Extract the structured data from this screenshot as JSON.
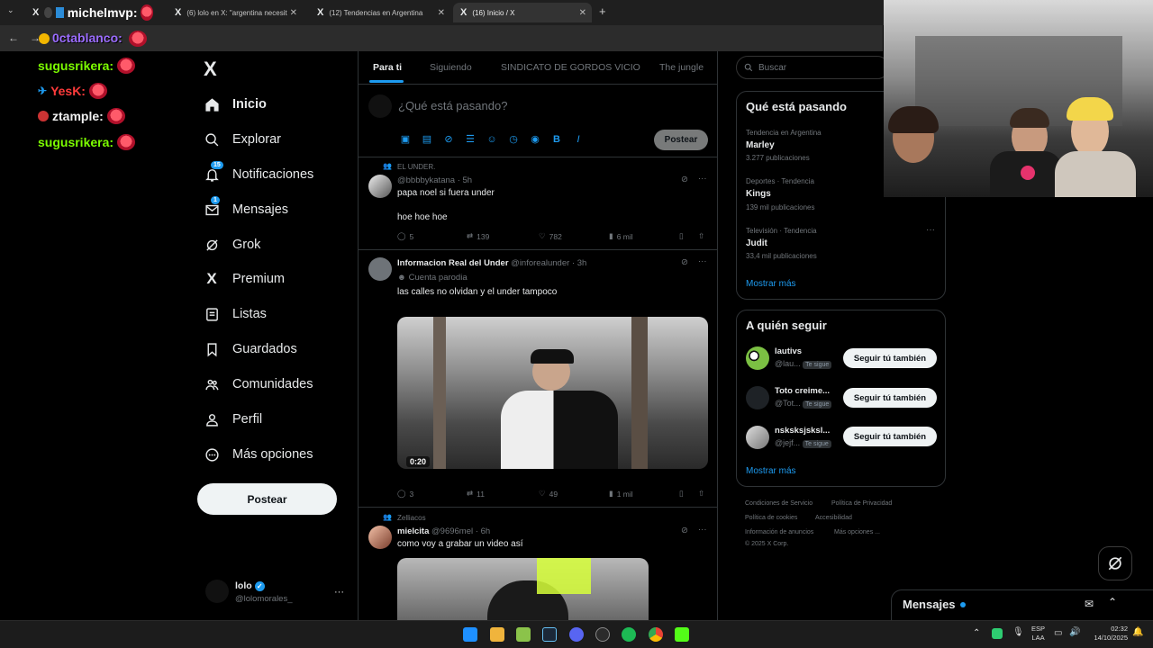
{
  "browser": {
    "tabs": [
      {
        "label": "michelmvp:",
        "overlay": true
      },
      {
        "label": "(6) lolo en X: \"argentina necesit"
      },
      {
        "label": "(12) Tendencias en Argentina"
      },
      {
        "label": "(16) Inicio / X"
      }
    ],
    "new_tab": "+",
    "address_overlay": "0ctablanco:"
  },
  "chat": [
    {
      "user": "sugusrikera:",
      "color": "#7cfc00"
    },
    {
      "user": "YesK:",
      "color": "#7cfc00"
    },
    {
      "user": "ztample:",
      "color": "#f0f0f0"
    },
    {
      "user": "sugusrikera:",
      "color": "#7cfc00"
    }
  ],
  "sidebar": {
    "logo": "X",
    "items": [
      {
        "label": "Inicio",
        "icon": "home-icon",
        "active": true
      },
      {
        "label": "Explorar",
        "icon": "search-icon"
      },
      {
        "label": "Notificaciones",
        "icon": "bell-icon",
        "badge": "15"
      },
      {
        "label": "Mensajes",
        "icon": "mail-icon",
        "badge": "1"
      },
      {
        "label": "Grok",
        "icon": "grok-icon"
      },
      {
        "label": "Premium",
        "icon": "x-icon"
      },
      {
        "label": "Listas",
        "icon": "list-icon"
      },
      {
        "label": "Guardados",
        "icon": "bookmark-icon"
      },
      {
        "label": "Comunidades",
        "icon": "people-icon"
      },
      {
        "label": "Perfil",
        "icon": "person-icon"
      },
      {
        "label": "Más opciones",
        "icon": "more-icon"
      }
    ],
    "post_button": "Postear",
    "account": {
      "name": "lolo",
      "handle": "@lolomorales_",
      "more": "···"
    }
  },
  "feed": {
    "tabs": [
      "Para ti",
      "Siguiendo",
      "SINDICATO DE GORDOS VICIO",
      "The jungle"
    ],
    "compose": {
      "placeholder": "¿Qué está pasando?",
      "button": "Postear"
    },
    "tweets": [
      {
        "context": "EL UNDER.",
        "name": "",
        "handle": "@bbbbykatana",
        "time": "· 5h",
        "lines": [
          "papa noel si fuera under",
          "hoe hoe hoe"
        ],
        "stats": {
          "replies": "5",
          "reposts": "139",
          "likes": "782",
          "views": "6 mil"
        }
      },
      {
        "context": "",
        "name": "Informacion Real del Under",
        "handle": "@inforealunder",
        "time": "· 3h",
        "sub": "Cuenta parodia",
        "lines": [
          "las calles no olvidan y el under tampoco"
        ],
        "video_duration": "0:20",
        "stats": {
          "replies": "3",
          "reposts": "11",
          "likes": "49",
          "views": "1 mil"
        }
      },
      {
        "context": "Zelliacos",
        "name": "mielcita",
        "handle": "@9696mel",
        "time": "· 6h",
        "lines": [
          "como voy a grabar un video así"
        ]
      }
    ]
  },
  "right": {
    "search_placeholder": "Buscar",
    "trends_title": "Qué está pasando",
    "trends": [
      {
        "context": "Tendencia en Argentina",
        "name": "Marley",
        "count": "3.277 publicaciones"
      },
      {
        "context": "Deportes · Tendencia",
        "name": "Kings",
        "count": "139 mil publicaciones"
      },
      {
        "context": "Televisión · Tendencia",
        "name": "Judit",
        "count": "33,4 mil publicaciones"
      }
    ],
    "show_more": "Mostrar más",
    "follow_title": "A quién seguir",
    "follow": [
      {
        "name": "lautivs",
        "handle": "@lau...",
        "tag": "Te sigue",
        "button": "Seguir tú también"
      },
      {
        "name": "Toto creime...",
        "handle": "@Tot...",
        "tag": "Te sigue",
        "button": "Seguir tú también"
      },
      {
        "name": "nsksksjsksl...",
        "handle": "@jejf...",
        "tag": "Te sigue",
        "button": "Seguir tú también"
      }
    ],
    "footer": [
      "Condiciones de Servicio",
      "Política de Privacidad",
      "Política de cookies",
      "Accesibilidad",
      "Información de anuncios",
      "Más opciones ...",
      "© 2025 X Corp."
    ]
  },
  "messages_drawer": {
    "label": "Mensajes"
  },
  "taskbar": {
    "lang": "ESP",
    "lang2": "LAA",
    "time": "02:32",
    "date": "14/10/2025"
  }
}
